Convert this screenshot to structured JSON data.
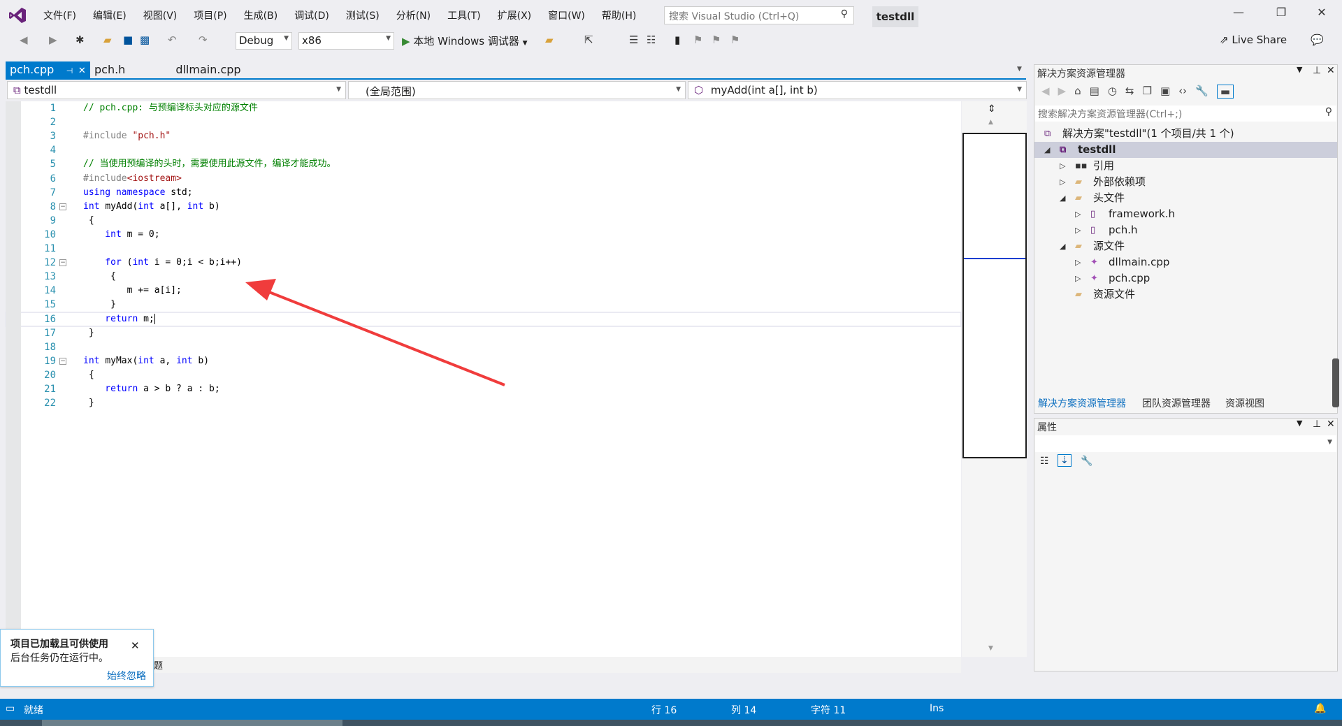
{
  "app": {
    "title": "testdll"
  },
  "menu": [
    "文件(F)",
    "编辑(E)",
    "视图(V)",
    "项目(P)",
    "生成(B)",
    "调试(D)",
    "测试(S)",
    "分析(N)",
    "工具(T)",
    "扩展(X)",
    "窗口(W)",
    "帮助(H)"
  ],
  "search": {
    "placeholder": "搜索 Visual Studio (Ctrl+Q)"
  },
  "toolbar": {
    "config": "Debug",
    "platform": "x86",
    "run_label": "本地 Windows 调试器",
    "live_share": "Live Share"
  },
  "tabs": [
    {
      "label": "pch.cpp",
      "active": true
    },
    {
      "label": "pch.h"
    },
    {
      "label": "dllmain.cpp"
    }
  ],
  "navbar": {
    "project": "testdll",
    "scope": "(全局范围)",
    "member": "myAdd(int a[], int b)"
  },
  "editor": {
    "lines": [
      [
        [
          "// pch.cpp: 与预编译标头对应的源文件",
          "cm"
        ]
      ],
      [],
      [
        [
          "#include ",
          "pp"
        ],
        [
          "\"pch.h\"",
          "st"
        ]
      ],
      [],
      [
        [
          "// 当使用预编译的头时，需要使用此源文件，编译才能成功。",
          "cm"
        ]
      ],
      [
        [
          "#include",
          "pp"
        ],
        [
          "<iostream>",
          "st"
        ]
      ],
      [
        [
          "using namespace ",
          "kw"
        ],
        [
          "std;",
          "tx"
        ]
      ],
      [
        [
          "int ",
          "kw"
        ],
        [
          "myAdd(",
          "tx"
        ],
        [
          "int ",
          "kw"
        ],
        [
          "a[], ",
          "tx"
        ],
        [
          "int ",
          "kw"
        ],
        [
          "b)",
          "tx"
        ]
      ],
      [
        [
          " {",
          "tx"
        ]
      ],
      [
        [
          "    int ",
          "kw"
        ],
        [
          "m = 0;",
          "tx"
        ]
      ],
      [],
      [
        [
          "    for ",
          "kw"
        ],
        [
          "(",
          "tx"
        ],
        [
          "int ",
          "kw"
        ],
        [
          "i = 0;i < b;i++)",
          "tx"
        ]
      ],
      [
        [
          "     {",
          "tx"
        ]
      ],
      [
        [
          "        m += a[i];",
          "tx"
        ]
      ],
      [
        [
          "     }",
          "tx"
        ]
      ],
      [
        [
          "    return ",
          "kw"
        ],
        [
          "m;",
          "tx"
        ]
      ],
      [
        [
          " }",
          "tx"
        ]
      ],
      [],
      [
        [
          "int ",
          "kw"
        ],
        [
          "myMax(",
          "tx"
        ],
        [
          "int ",
          "kw"
        ],
        [
          "a, ",
          "tx"
        ],
        [
          "int ",
          "kw"
        ],
        [
          "b)",
          "tx"
        ]
      ],
      [
        [
          " {",
          "tx"
        ]
      ],
      [
        [
          "    return ",
          "kw"
        ],
        [
          "a > b ? a : b;",
          "tx"
        ]
      ],
      [
        [
          " }",
          "tx"
        ]
      ]
    ],
    "current_line": 16,
    "fold_lines": [
      8,
      12,
      19
    ]
  },
  "solution_explorer": {
    "title": "解决方案资源管理器",
    "search_placeholder": "搜索解决方案资源管理器(Ctrl+;)",
    "items": [
      {
        "label": "解决方案\"testdll\"(1 个项目/共 1 个)",
        "level": 0,
        "icon": "solution-icon"
      },
      {
        "label": "testdll",
        "level": 0,
        "icon": "project-icon",
        "expanded": true,
        "selected": true
      },
      {
        "label": "引用",
        "level": 1,
        "icon": "references-icon",
        "expanded": false
      },
      {
        "label": "外部依赖项",
        "level": 1,
        "icon": "external-deps-icon",
        "expanded": false
      },
      {
        "label": "头文件",
        "level": 1,
        "icon": "filter-folder-icon",
        "expanded": true
      },
      {
        "label": "framework.h",
        "level": 2,
        "icon": "header-file-icon",
        "expanded": false
      },
      {
        "label": "pch.h",
        "level": 2,
        "icon": "header-file-icon",
        "expanded": false
      },
      {
        "label": "源文件",
        "level": 1,
        "icon": "filter-folder-icon",
        "expanded": true
      },
      {
        "label": "dllmain.cpp",
        "level": 2,
        "icon": "cpp-file-icon",
        "expanded": false
      },
      {
        "label": "pch.cpp",
        "level": 2,
        "icon": "cpp-file-icon",
        "expanded": false
      },
      {
        "label": "资源文件",
        "level": 1,
        "icon": "filter-folder-icon"
      }
    ],
    "bottom_tabs": [
      "解决方案资源管理器",
      "团队资源管理器",
      "资源视图"
    ]
  },
  "properties": {
    "title": "属性"
  },
  "toast": {
    "title": "项目已加载且可供使用",
    "body": "后台任务仍在运行中。",
    "link": "始终忽略",
    "partial_tab": "题"
  },
  "status": {
    "state": "就绪",
    "line": "行 16",
    "col": "列 14",
    "char": "字符 11",
    "mode": "Ins"
  },
  "colors": {
    "accent": "#007acc",
    "arrow": "#f03c3c"
  }
}
